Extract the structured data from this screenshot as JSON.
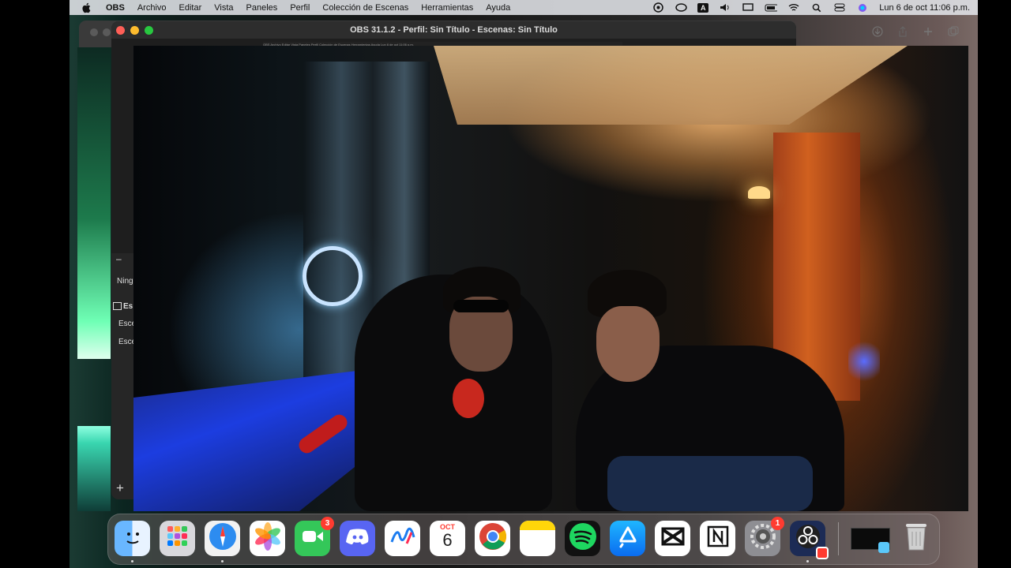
{
  "menubar": {
    "app_name": "OBS",
    "menus": [
      "Archivo",
      "Editar",
      "Vista",
      "Paneles",
      "Perfil",
      "Colección de Escenas",
      "Herramientas",
      "Ayuda"
    ],
    "input_source": "A",
    "clock": "Lun 6 de oct  11:06 p.m."
  },
  "obs_window": {
    "title": "OBS 31.1.2 - Perfil: Sin Título - Escenas: Sin Título",
    "panel": {
      "minus": "–",
      "truncated_none": "Ning",
      "scenes_header": "Es",
      "scene_1": "Esce",
      "scene_2": "Esce",
      "add": "+"
    },
    "mini_menubar": "OBS  Archivo  Editar  Vista  Paneles  Perfil  Colección de Escenas  Herramientas  Ayuda        Lun 6 de oct 11:06 p.m."
  },
  "dock": {
    "messages_badge": "3",
    "calendar_month": "OCT",
    "calendar_day": "6",
    "settings_badge": "1"
  },
  "colors": {
    "close": "#ff5f57",
    "minimize": "#febc2e",
    "zoom": "#28c840",
    "menubar_bg": "#e1e4e8",
    "badge": "#ff3b30"
  }
}
